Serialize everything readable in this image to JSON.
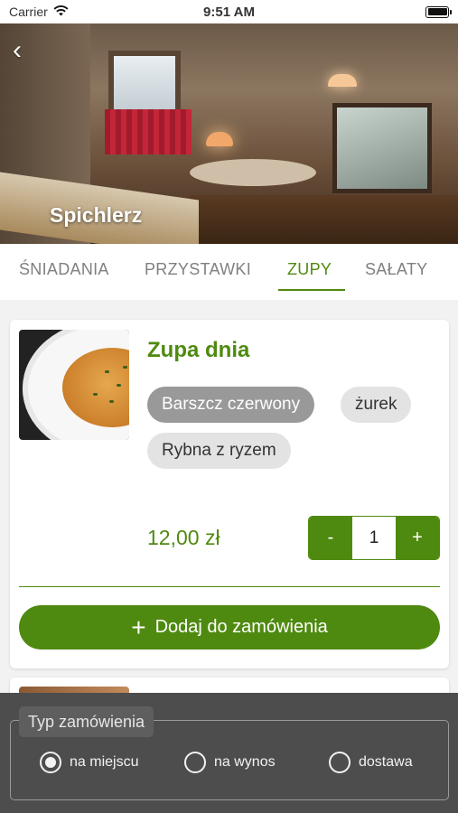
{
  "status_bar": {
    "carrier": "Carrier",
    "time": "9:51 AM"
  },
  "header": {
    "title": "Spichlerz",
    "back_icon": "chevron-left-icon"
  },
  "tabs": [
    {
      "label": "ŚNIADANIA",
      "active": false
    },
    {
      "label": "PRZYSTAWKI",
      "active": false
    },
    {
      "label": "ZUPY",
      "active": true
    },
    {
      "label": "SAŁATY",
      "active": false
    }
  ],
  "product": {
    "title": "Zupa dnia",
    "options": [
      {
        "label": "Barszcz czerwony",
        "selected": true
      },
      {
        "label": "żurek",
        "selected": false
      },
      {
        "label": "Rybna z ryzem",
        "selected": false
      }
    ],
    "price": "12,00 zł",
    "quantity": {
      "minus": "-",
      "value": "1",
      "plus": "+"
    },
    "add_button": {
      "icon": "+",
      "label": "Dodaj do zamówienia"
    }
  },
  "order_type": {
    "legend": "Typ zamówienia",
    "options": [
      {
        "label": "na miejscu",
        "selected": true
      },
      {
        "label": "na wynos",
        "selected": false
      },
      {
        "label": "dostawa",
        "selected": false
      }
    ]
  },
  "colors": {
    "accent": "#4f8a10",
    "panel": "#4d4d4d",
    "chip_selected": "#999999",
    "chip": "#e3e3e3"
  }
}
